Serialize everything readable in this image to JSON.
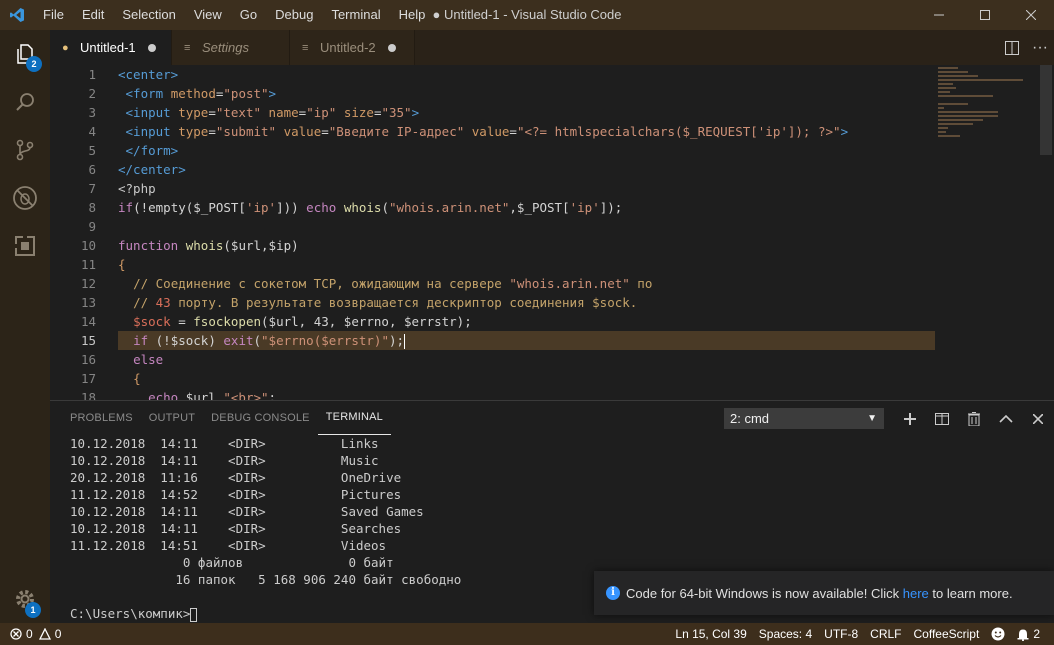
{
  "titlebar": {
    "menu": [
      "File",
      "Edit",
      "Selection",
      "View",
      "Go",
      "Debug",
      "Terminal",
      "Help"
    ],
    "title": "● Untitled-1 - Visual Studio Code"
  },
  "activitybar": {
    "explorer_badge": "2",
    "settings_badge": "1"
  },
  "tabs": [
    {
      "label": "Untitled-1",
      "icon": "php-file-icon"
    },
    {
      "label": "Settings",
      "icon": "settings-file-icon"
    },
    {
      "label": "Untitled-2",
      "icon": "text-file-icon"
    }
  ],
  "editor": {
    "line_numbers": [
      "1",
      "2",
      "3",
      "4",
      "5",
      "6",
      "7",
      "8",
      "9",
      "10",
      "11",
      "12",
      "13",
      "14",
      "15",
      "16",
      "17",
      "18"
    ],
    "current_line": 15
  },
  "panel": {
    "tabs": [
      "PROBLEMS",
      "OUTPUT",
      "DEBUG CONSOLE",
      "TERMINAL"
    ],
    "terminal_selector": "2: cmd",
    "terminal_lines": [
      "10.12.2018  14:11    <DIR>          Links",
      "10.12.2018  14:11    <DIR>          Music",
      "20.12.2018  11:16    <DIR>          OneDrive",
      "11.12.2018  14:52    <DIR>          Pictures",
      "10.12.2018  14:11    <DIR>          Saved Games",
      "10.12.2018  14:11    <DIR>          Searches",
      "11.12.2018  14:51    <DIR>          Videos",
      "               0 файлов              0 байт",
      "              16 папок   5 168 906 240 байт свободно",
      "",
      "C:\\Users\\компик>"
    ]
  },
  "notification": {
    "text_before": "Code for 64-bit Windows is now available! Click ",
    "link": "here",
    "text_after": " to learn more."
  },
  "statusbar": {
    "errors": "0",
    "warnings": "0",
    "position": "Ln 15, Col 39",
    "spaces": "Spaces: 4",
    "encoding": "UTF-8",
    "eol": "CRLF",
    "language": "CoffeeScript",
    "notifications": "2"
  },
  "colors": {
    "titlebar": "#3c2f1e",
    "activitybar": "#2c2418",
    "statusbar": "#3d2e1c",
    "badge": "#0e70c0",
    "link": "#3794ff"
  }
}
